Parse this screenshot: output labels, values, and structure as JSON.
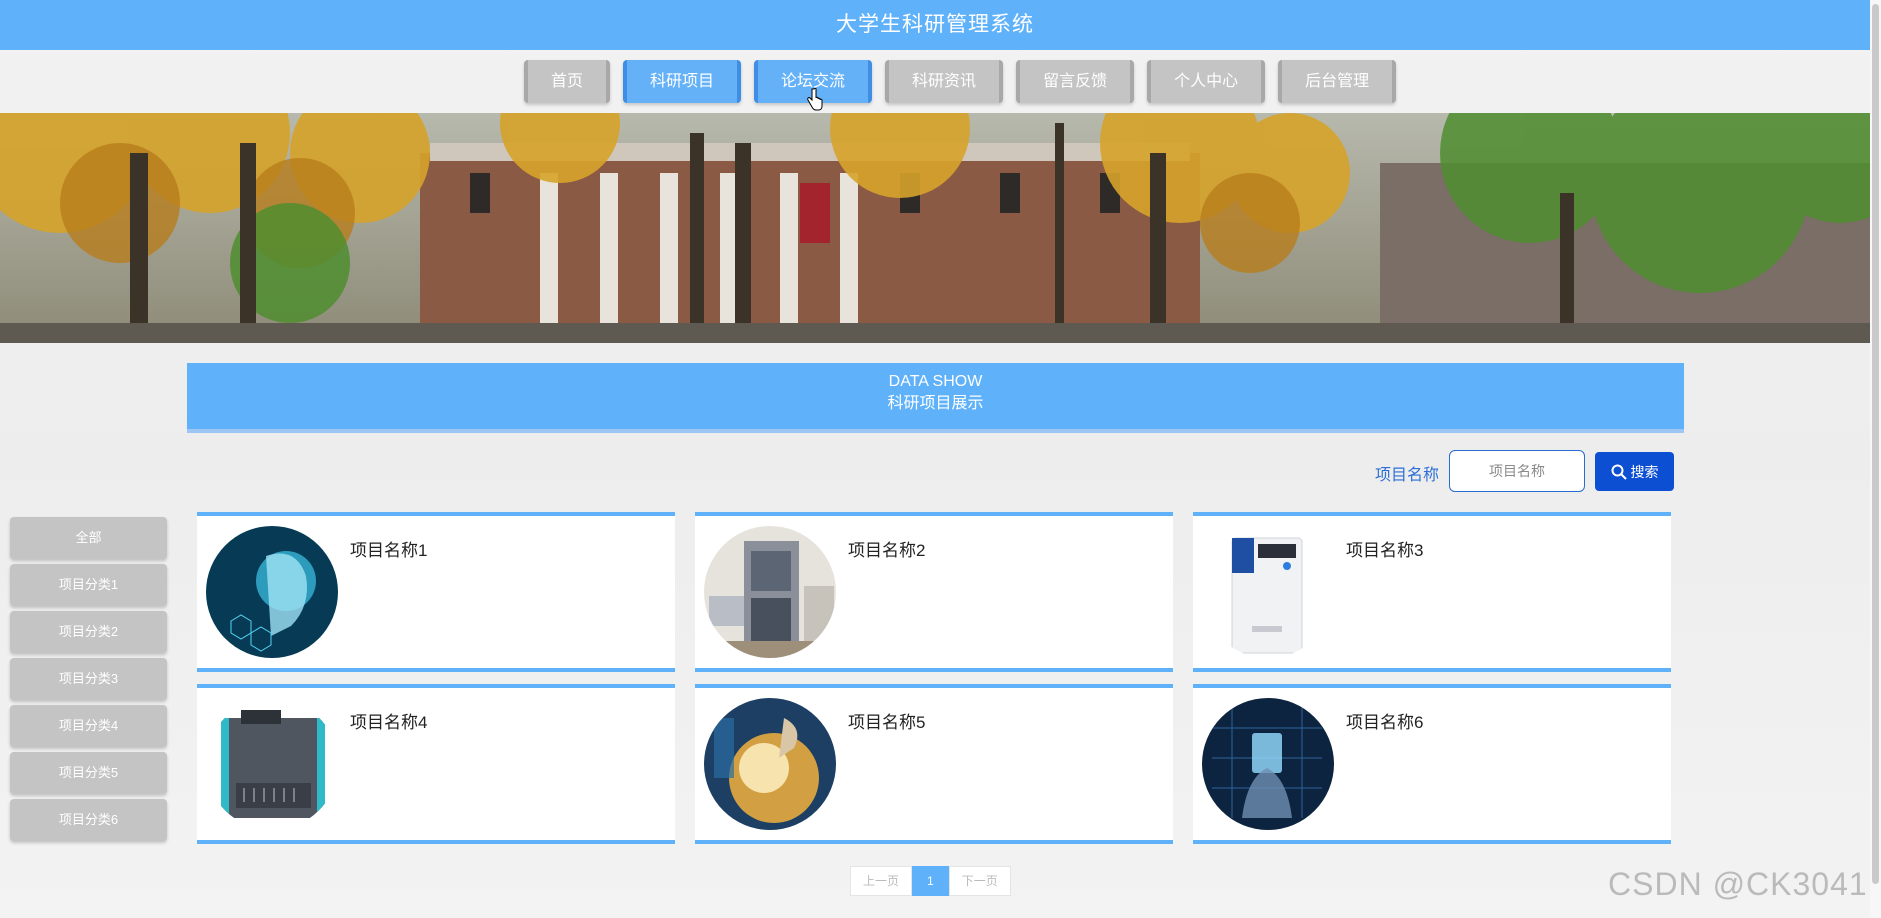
{
  "header": {
    "title": "大学生科研管理系统"
  },
  "nav": {
    "items": [
      {
        "label": "首页"
      },
      {
        "label": "科研项目",
        "active": true
      },
      {
        "label": "论坛交流",
        "active": true
      },
      {
        "label": "科研资讯"
      },
      {
        "label": "留言反馈"
      },
      {
        "label": "个人中心"
      },
      {
        "label": "后台管理"
      }
    ]
  },
  "section": {
    "title_en": "DATA SHOW",
    "title_cn": "科研项目展示"
  },
  "search": {
    "label": "项目名称",
    "placeholder": "项目名称",
    "button": "搜索"
  },
  "sidebar": {
    "items": [
      {
        "label": "全部"
      },
      {
        "label": "项目分类1"
      },
      {
        "label": "项目分类2"
      },
      {
        "label": "项目分类3"
      },
      {
        "label": "项目分类4"
      },
      {
        "label": "项目分类5"
      },
      {
        "label": "项目分类6"
      }
    ]
  },
  "projects": [
    {
      "title": "项目名称1",
      "image": "ai-robot-head"
    },
    {
      "title": "项目名称2",
      "image": "lab-instrument-cabinet"
    },
    {
      "title": "项目名称3",
      "image": "water-purifier-device"
    },
    {
      "title": "项目名称4",
      "image": "pcr-machine"
    },
    {
      "title": "项目名称5",
      "image": "lab-glassware"
    },
    {
      "title": "项目名称6",
      "image": "digital-hand-chip"
    }
  ],
  "pagination": {
    "prev": "上一页",
    "current": "1",
    "next": "下一页"
  },
  "watermark": "CSDN @CK3041"
}
